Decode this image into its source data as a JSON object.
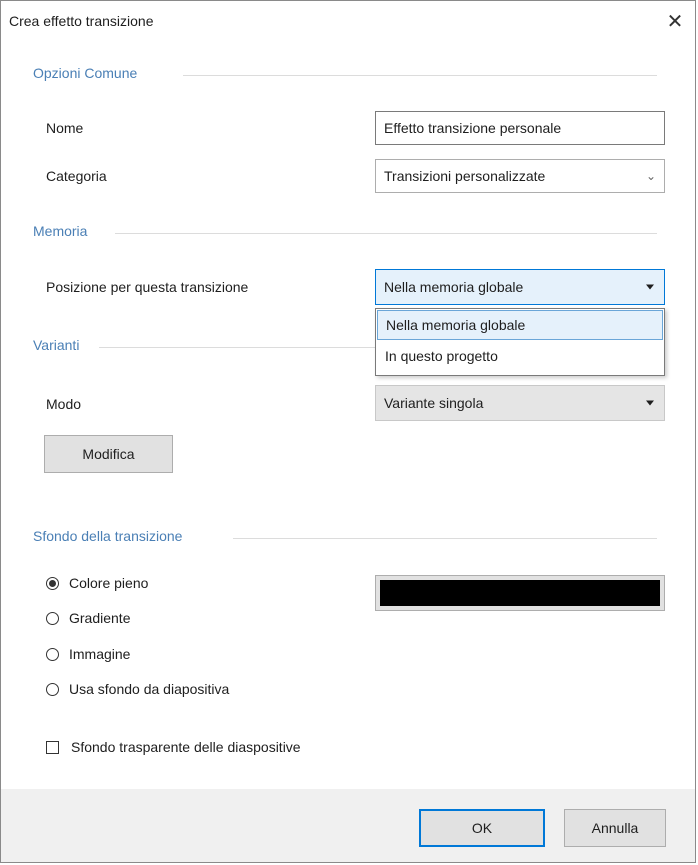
{
  "window": {
    "title": "Crea effetto transizione",
    "close_glyph": "✕"
  },
  "sections": {
    "common": "Opzioni Comune",
    "memory": "Memoria",
    "variants": "Varianti",
    "background": "Sfondo della transizione"
  },
  "common": {
    "name_label": "Nome",
    "name_value": "Effetto transizione personale",
    "category_label": "Categoria",
    "category_value": "Transizioni personalizzate"
  },
  "memory": {
    "position_label": "Posizione per questa transizione",
    "position_value": "Nella memoria globale",
    "options": [
      "Nella memoria globale",
      "In questo progetto"
    ]
  },
  "variants": {
    "mode_label": "Modo",
    "mode_value": "Variante singola",
    "edit_button": "Modifica"
  },
  "background": {
    "options": [
      "Colore pieno",
      "Gradiente",
      "Immagine",
      "Usa sfondo da diapositiva"
    ],
    "selected_index": 0,
    "color_value": "#000000",
    "transparent_label": "Sfondo trasparente delle diaspositive",
    "transparent_checked": false
  },
  "footer": {
    "ok_label": "OK",
    "cancel_label": "Annulla"
  },
  "colors": {
    "accent": "#0078d7",
    "section_header": "#4a7fb5"
  }
}
